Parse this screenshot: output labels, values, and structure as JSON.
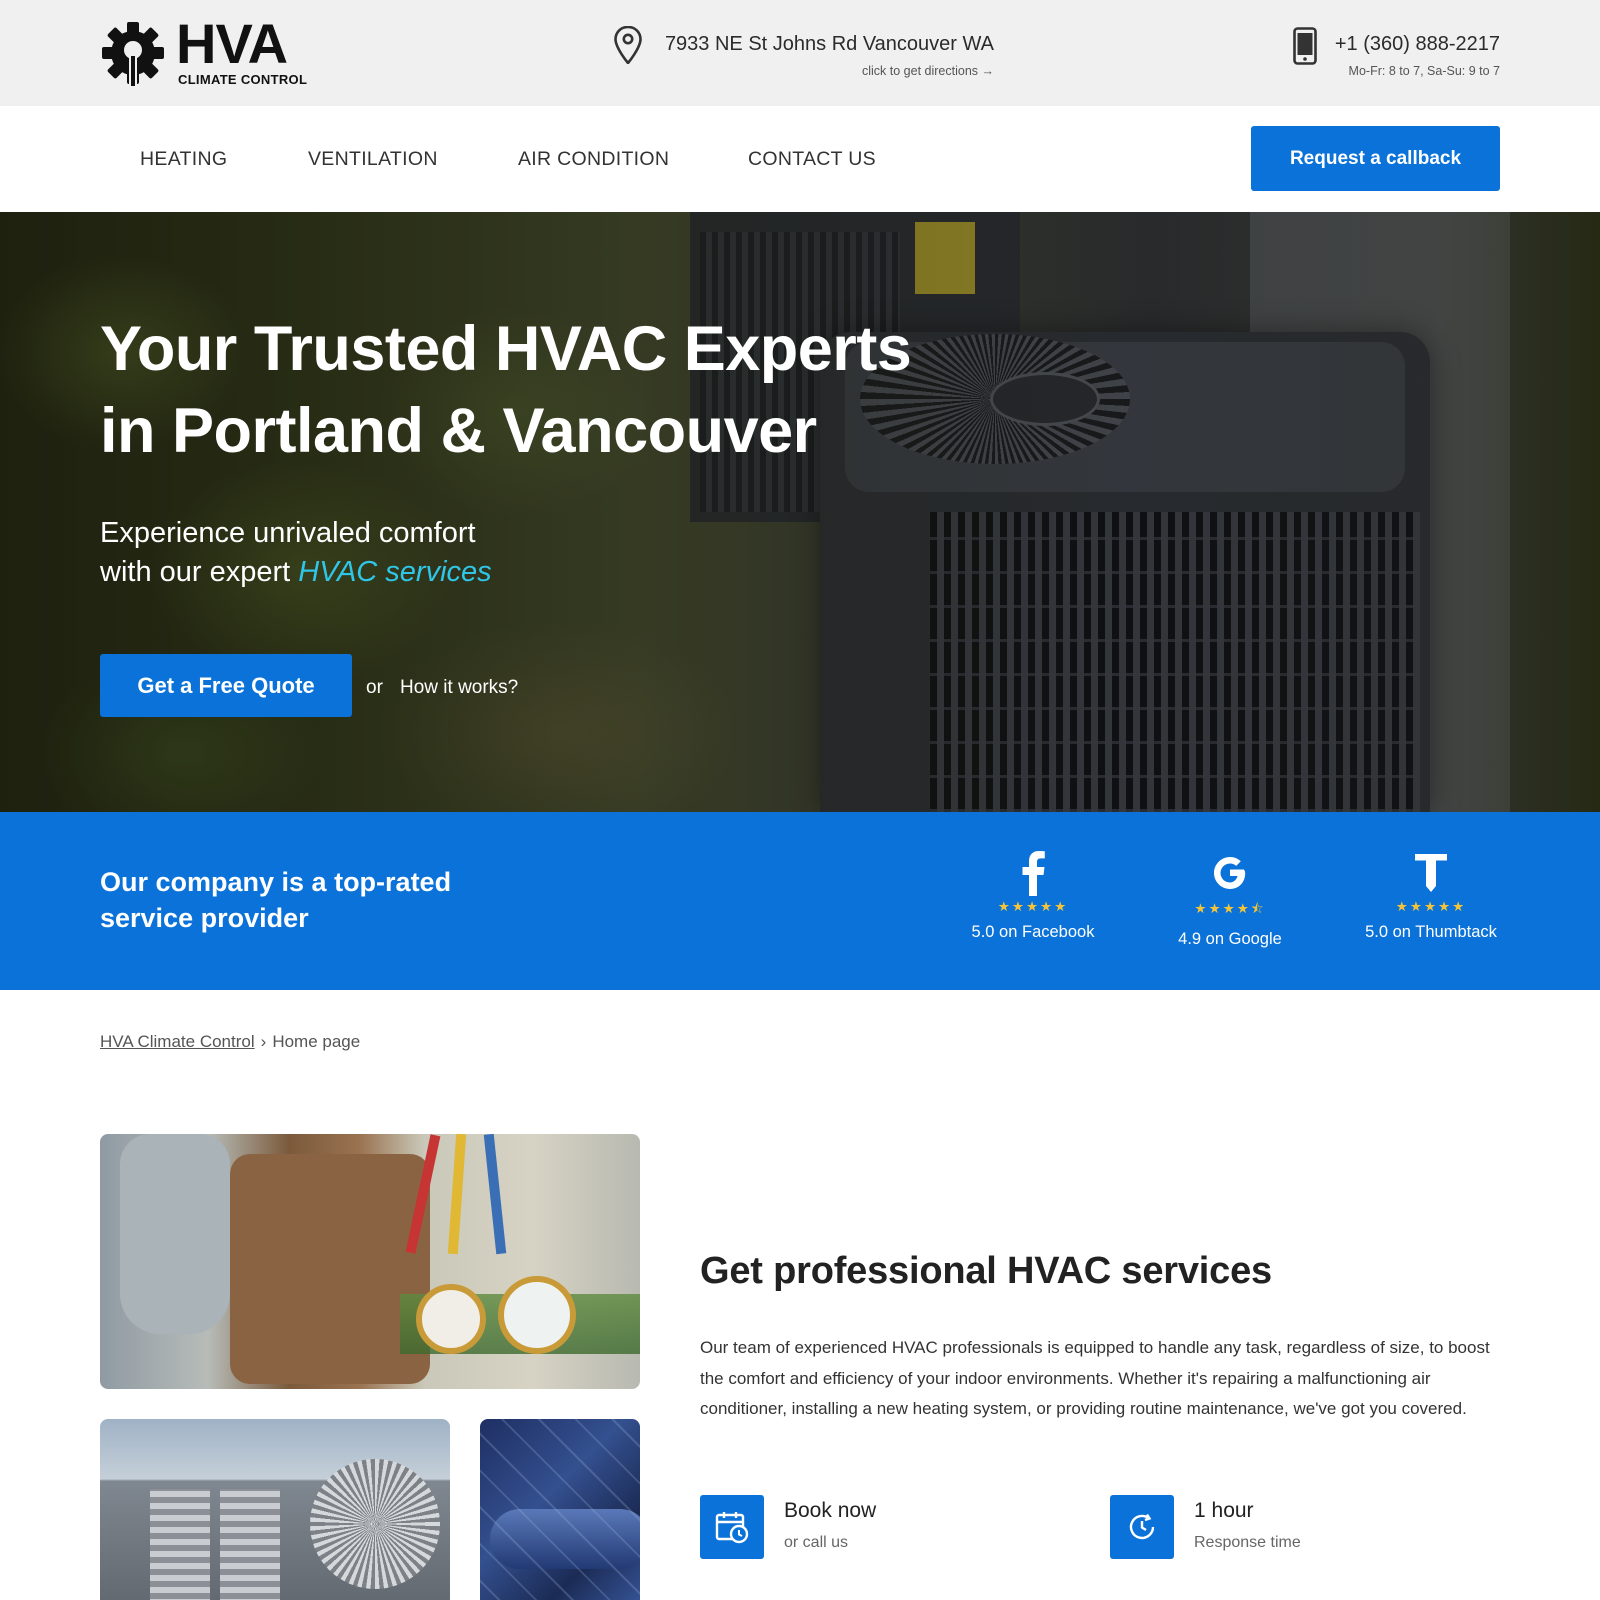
{
  "brand": {
    "logo_text": "HVA",
    "logo_sub": "CLIMATE CONTROL"
  },
  "topbar": {
    "address": "7933 NE St Johns Rd Vancouver WA",
    "address_hint": "click to get directions →",
    "phone": "+1 (360) 888-2217",
    "hours": "Mo-Fr: 8 to 7, Sa-Su: 9 to 7",
    "icons": [
      "map-pin-icon",
      "mobile-phone-icon"
    ]
  },
  "nav": {
    "items": [
      {
        "label": "HEATING"
      },
      {
        "label": "VENTILATION"
      },
      {
        "label": "AIR CONDITION"
      },
      {
        "label": "CONTACT US"
      }
    ],
    "cta": "Request a callback"
  },
  "hero": {
    "title_line1": "Your Trusted HVAC Experts",
    "title_line2": "in Portland & Vancouver",
    "subtitle_line1": "Experience unrivaled comfort",
    "subtitle_line2_prefix": "with our expert ",
    "subtitle_highlight": "HVAC services",
    "quote_button": "Get a Free Quote",
    "or_text": "or",
    "how_link": "How it works?"
  },
  "ratings": {
    "headline_line1": "Our company is a top-rated",
    "headline_line2": "service provider",
    "items": [
      {
        "icon": "facebook-icon",
        "stars": "★★★★★",
        "rating": 5.0,
        "label": "5.0 on Facebook"
      },
      {
        "icon": "google-icon",
        "stars": "★★★★⯪",
        "rating": 4.9,
        "label": "4.9 on Google"
      },
      {
        "icon": "thumbtack-icon",
        "stars": "★★★★★",
        "rating": 5.0,
        "label": "5.0 on Thumbtack"
      }
    ],
    "star_color": "#f3c43a"
  },
  "breadcrumb": {
    "home": "HVA Climate Control",
    "separator": "›",
    "current": "Home page"
  },
  "services": {
    "title": "Get professional HVAC services",
    "body": "Our team of experienced HVAC professionals is equipped to handle any task, regardless of size, to boost the comfort and efficiency of your indoor environments. Whether it's repairing a malfunctioning air conditioner, installing a new heating system, or providing routine maintenance, we've got you covered.",
    "features": [
      {
        "icon": "calendar-clock-icon",
        "title": "Book now",
        "subtitle": "or call us"
      },
      {
        "icon": "clock-refresh-icon",
        "title": "1 hour",
        "subtitle": "Response time"
      }
    ]
  },
  "colors": {
    "accent": "#0a72d8",
    "highlight": "#2fc6e8",
    "topbar_bg": "#f0f0f0"
  }
}
